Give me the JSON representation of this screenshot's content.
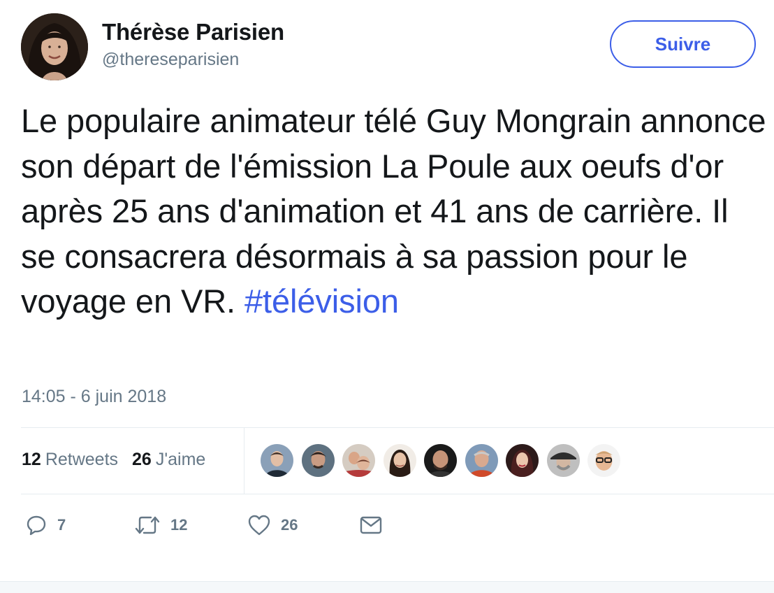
{
  "author": {
    "name": "Thérèse Parisien",
    "handle": "@thereseparisien"
  },
  "follow_label": "Suivre",
  "tweet": {
    "text_plain": "Le populaire animateur télé Guy Mongrain annonce son départ de l'émission La Poule aux oeufs d'or après 25 ans d'animation et 41 ans de carrière. Il se consacrera désormais à sa passion pour le voyage en VR.",
    "hashtag": "#télévision",
    "timestamp": "14:05 - 6 juin 2018"
  },
  "stats": {
    "retweets_count": "12",
    "retweets_label": "Retweets",
    "likes_count": "26",
    "likes_label": "J'aime"
  },
  "actions": {
    "reply_count": "7",
    "retweet_count": "12",
    "like_count": "26"
  },
  "colors": {
    "accent": "#3c5ee8",
    "muted": "#657786",
    "text": "#14171a",
    "divider": "#e6ecf0"
  },
  "icons": [
    "reply-icon",
    "retweet-icon",
    "heart-icon",
    "envelope-icon"
  ]
}
